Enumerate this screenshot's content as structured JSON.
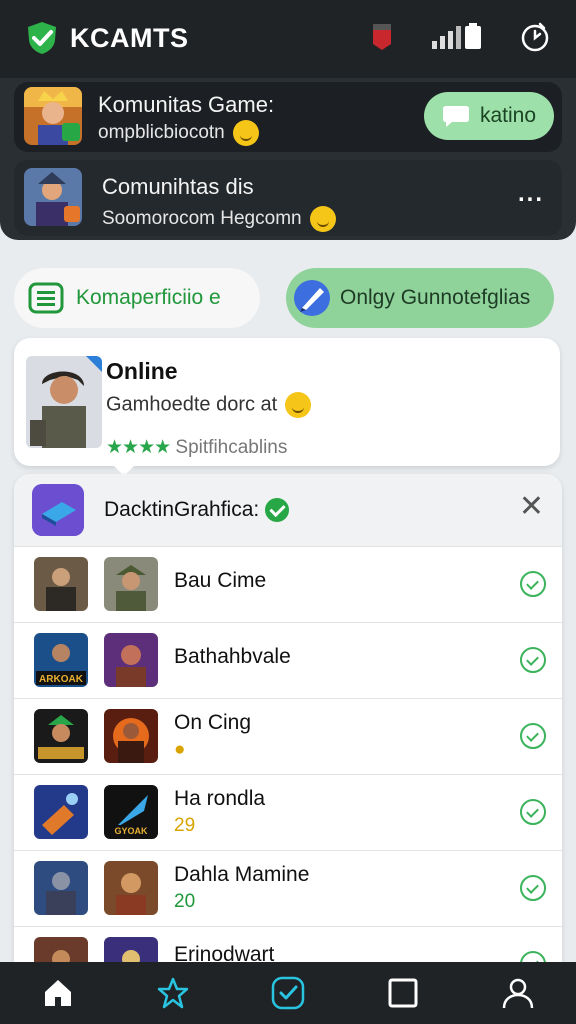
{
  "app": {
    "name": "KCAMTS"
  },
  "notifications": [
    {
      "title": "Komunitas Game:",
      "subtitle": "ompblicbiocotn",
      "action_label": "katino"
    },
    {
      "title": "Comunihtas dis",
      "subtitle": "Soomorocom Hegcomn",
      "action_label": "..."
    }
  ],
  "filters": [
    {
      "label": "Komaperficiio e"
    },
    {
      "label": "Onlgy Gunnotefglias"
    }
  ],
  "online_card": {
    "title": "Online",
    "subtitle": "Gamhoedte dorc at",
    "stars": "★★★★",
    "rating_text": "Spitfihcablins"
  },
  "list": {
    "header_title": "DacktinGrahfica:",
    "close_glyph": "✕",
    "rows": [
      {
        "name": "Bau Cime",
        "sub": "",
        "sub_color": "gold"
      },
      {
        "name": "Bathahbvale",
        "sub": "",
        "sub_color": "gold"
      },
      {
        "name": "On Cing",
        "sub": "",
        "sub_color": "gold"
      },
      {
        "name": "Ha rondla",
        "sub": "29",
        "sub_color": "gold"
      },
      {
        "name": "Dahla Mamine",
        "sub": "20",
        "sub_color": "green"
      },
      {
        "name": "Erinodwart",
        "sub": "",
        "sub_color": "gold"
      }
    ]
  },
  "colors": {
    "accent_green": "#27a745",
    "dark": "#1f2326",
    "pill_green": "#8fd39b"
  },
  "nav": [
    {
      "icon": "home-icon"
    },
    {
      "icon": "star-icon"
    },
    {
      "icon": "shield-check-icon"
    },
    {
      "icon": "square-icon"
    },
    {
      "icon": "profile-icon"
    }
  ]
}
